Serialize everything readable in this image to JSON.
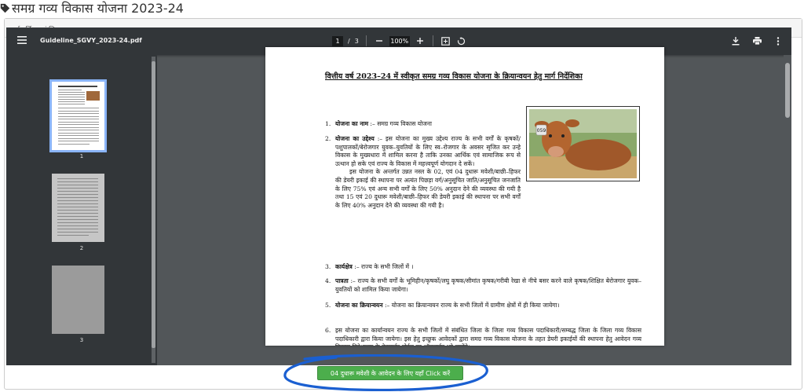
{
  "page": {
    "title": "समग्र गव्य विकास योजना 2023-24"
  },
  "panel": {
    "heading": "मार्ग-दर्शिका एवं जिलवार लक्ष्य"
  },
  "viewer": {
    "filename": "Guideline_SGVY_2023-24.pdf",
    "current_page": "1",
    "page_sep": "/",
    "total_pages": "3",
    "zoom": "100%",
    "thumbnails": [
      {
        "label": "1"
      },
      {
        "label": "2"
      },
      {
        "label": "3"
      }
    ],
    "icons": [
      "menu-icon",
      "zoom-out-icon",
      "zoom-in-icon",
      "fit-page-icon",
      "rotate-icon",
      "download-icon",
      "print-icon",
      "more-icon"
    ]
  },
  "document": {
    "title": "वित्तीय वर्ष 2023–24 में स्वीकृत समग्र गव्य विकास योजना के क्रियान्वयन हेतु मार्ग निर्देशिका",
    "items": [
      {
        "num": "1.",
        "heading": "योजना का नाम",
        "text": ":– समग्र गव्य विकास योजना"
      },
      {
        "num": "2.",
        "heading": "योजना का उद्देश्य",
        "text": ":– इस योजना का मुख्य उद्देश्य राज्य के सभी वर्गों के कृषकों/पशुपालकों/बेरोजगार युवक–युवतियों के लिए स्व–रोजगार के अवसर सृजित कर उन्हे विकास के मुख्यधारा में शामिल करना है ताकि उनका आर्थिक एवं सामाजिक रूप से उत्थान हो सके एवं राज्य के विकास में महत्त्वपूर्ण योगदान दे सकें।",
        "text2": "इस योजना के अन्तर्गत उन्नत नस्ल के 02, एवं 04 दुधारू मवेशी/बाछी–हिफर की डेयरी इकाई की स्थापना पर अत्यंत पिछड़ा वर्ग/अनुसूचित जाति/अनुसूचित जनजाति के लिए 75% एवं अन्य सभी वर्गों के लिए 50% अनुदान देने की व्यवस्था की गयी है तथा 15 एवं 20 दुधारू मवेशी/बाछी–हिफर की डेयरी इकाई की स्थापना पर सभी वर्गों के लिए 40% अनुदान देने की व्यवस्था की गयी है।"
      },
      {
        "num": "3.",
        "heading": "कार्यक्षेत्र",
        "text": ":– राज्य के सभी जिलों में ।"
      },
      {
        "num": "4.",
        "heading": "पात्रता",
        "text": ":– राज्य के सभी वर्गों के भूमिहीन/कृषकों/लघु कृषक/सीमांत कृषक/गरीबी रेखा से नीचे बसर करने वाले कृषक/शिक्षित बेरोजगार युवक–युवतियों को शामिल किया जायेगा।"
      },
      {
        "num": "5.",
        "heading": "योजना का क्रियान्वयन",
        "text": ":– योजना का क्रियान्वयन राज्य के सभी जिलों में ग्रामीण क्षेत्रों में ही किया जायेगा।"
      },
      {
        "num": "6.",
        "heading": "",
        "text": "इस योजना का कार्यान्वयन राज्य के सभी जिलों में संबंधित जिला के जिला गव्य विकास पदाधिकारी/सम्बद्ध जिला के जिला गव्य विकास पदाधिकारी द्वारा किया जायेगा। इस हेतु इच्छुक आवेदकों द्वारा समग्र गव्य विकास योजना के तहत डेयरी इकाईयों की स्थापना हेतु आवेदन गव्य विकास निदेशालय के वेबसाईट पोर्टल पर ऑनलाईन भरे जायेंगे।"
      }
    ],
    "image_tag": "059"
  },
  "cta": {
    "label": "04 दुधारू मवेशी के आवेदन के लिए यहाँ Click करें"
  },
  "colors": {
    "toolbar": "#323639",
    "viewer_bg": "#525659",
    "cta": "#4cae4c",
    "annotation": "#1a5fd1"
  }
}
